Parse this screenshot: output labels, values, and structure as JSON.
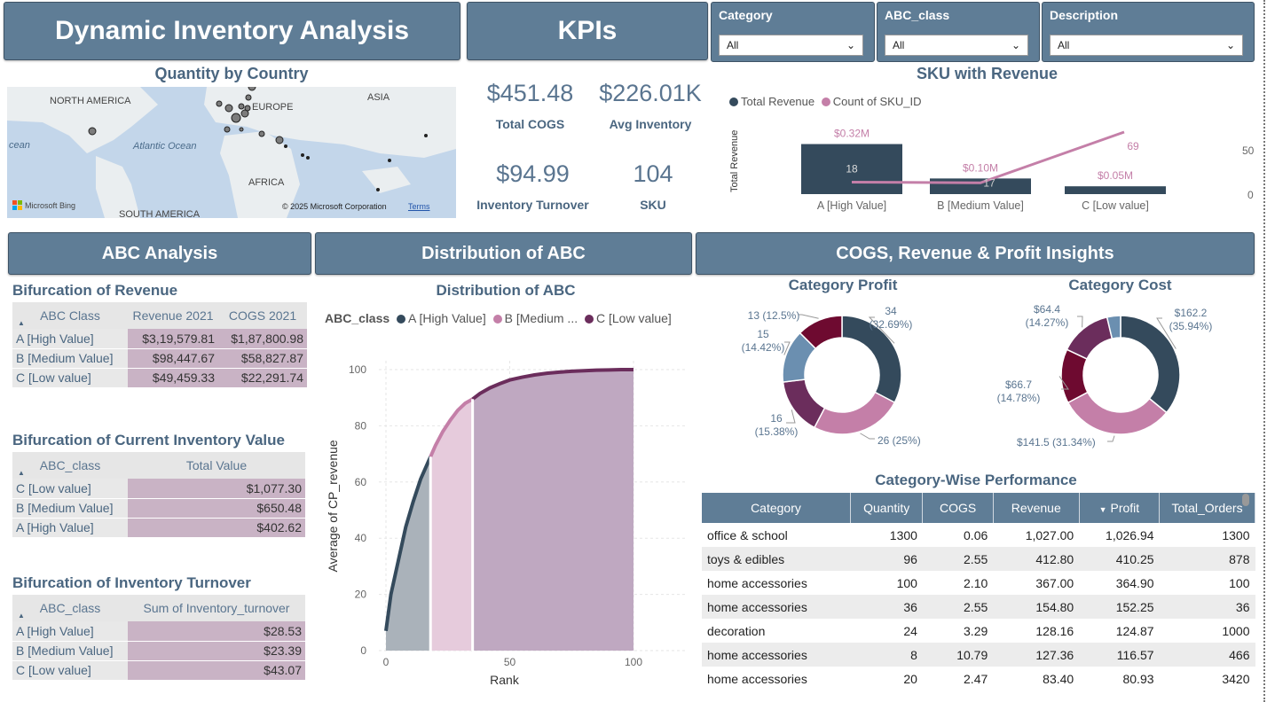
{
  "header": {
    "title": "Dynamic Inventory Analysis",
    "kpi_title": "KPIs"
  },
  "slicers": [
    {
      "label": "Category",
      "value": "All"
    },
    {
      "label": "ABC_class",
      "value": "All"
    },
    {
      "label": "Description",
      "value": "All"
    }
  ],
  "map": {
    "title": "Quantity by Country",
    "labels": {
      "north_america": "NORTH AMERICA",
      "europe": "EUROPE",
      "asia": "ASIA",
      "africa": "AFRICA",
      "south_america": "SOUTH AMERICA",
      "ocean_atlantic": "Atlantic Ocean",
      "ocean_left": "cean"
    },
    "bing": "Microsoft Bing",
    "copyright": "© 2025 Microsoft Corporation",
    "terms": "Terms"
  },
  "kpis": [
    {
      "value": "$451.48",
      "label": "Total COGS"
    },
    {
      "value": "$226.01K",
      "label": "Avg Inventory"
    },
    {
      "value": "$94.99",
      "label": "Inventory Turnover"
    },
    {
      "value": "104",
      "label": "SKU"
    }
  ],
  "sections": {
    "abc": "ABC  Analysis",
    "dist": "Distribution of ABC",
    "insights": "COGS, Revenue & Profit Insights"
  },
  "revenue_table": {
    "title": "Bifurcation of Revenue",
    "headers": [
      "ABC Class",
      "Revenue 2021",
      "COGS 2021"
    ],
    "rows": [
      [
        "A [High Value]",
        "$3,19,579.81",
        "$1,87,800.98"
      ],
      [
        "B [Medium Value]",
        "$98,447.67",
        "$58,827.87"
      ],
      [
        "C [Low value]",
        "$49,459.33",
        "$22,291.74"
      ]
    ]
  },
  "inventory_table": {
    "title": "Bifurcation of Current Inventory Value",
    "headers": [
      "ABC_class",
      "Total Value"
    ],
    "rows": [
      [
        "C [Low value]",
        "$1,077.30"
      ],
      [
        "B [Medium Value]",
        "$650.48"
      ],
      [
        "A [High Value]",
        "$402.62"
      ]
    ]
  },
  "turnover_table": {
    "title": "Bifurcation of Inventory Turnover",
    "headers": [
      "ABC_class",
      "Sum of Inventory_turnover"
    ],
    "rows": [
      [
        "A [High Value]",
        "$28.53"
      ],
      [
        "B [Medium Value]",
        "$23.39"
      ],
      [
        "C [Low value]",
        "$43.07"
      ]
    ]
  },
  "perf_table": {
    "title": "Category-Wise Performance",
    "headers": [
      "Category",
      "Quantity",
      "COGS",
      "Revenue",
      "Profit",
      "Total_Orders"
    ],
    "rows": [
      [
        "office & school",
        "1300",
        "0.06",
        "1,027.00",
        "1,026.94",
        "1300"
      ],
      [
        "toys & edibles",
        "96",
        "2.55",
        "412.80",
        "410.25",
        "878"
      ],
      [
        "home accessories",
        "100",
        "2.10",
        "367.00",
        "364.90",
        "100"
      ],
      [
        "home accessories",
        "36",
        "2.55",
        "154.80",
        "152.25",
        "36"
      ],
      [
        "decoration",
        "24",
        "3.29",
        "128.16",
        "124.87",
        "1000"
      ],
      [
        "home accessories",
        "8",
        "10.79",
        "127.36",
        "116.57",
        "466"
      ],
      [
        "home accessories",
        "20",
        "2.47",
        "83.40",
        "80.93",
        "3420"
      ]
    ]
  },
  "colors": {
    "a": "#344a5c",
    "b": "#c47fa8",
    "c": "#6b2d5c",
    "d": "#6b8fb0",
    "e": "#6e0a30",
    "banner": "#5f7d96"
  },
  "chart_data": [
    {
      "type": "bar",
      "title": "SKU with Revenue",
      "legend": [
        "Total Revenue",
        "Count of SKU_ID"
      ],
      "legend_position": "top-left",
      "categories": [
        "A [High Value]",
        "B [Medium Value]",
        "C [Low value]"
      ],
      "series": [
        {
          "name": "Total Revenue",
          "values": [
            0.32,
            0.1,
            0.05
          ],
          "labels": [
            "$0.32M",
            "$0.10M",
            "$0.05M"
          ]
        },
        {
          "name": "Count of SKU_ID",
          "values": [
            18,
            17,
            69
          ],
          "labels": [
            "18",
            "17",
            "69"
          ]
        }
      ],
      "ylabel": "Total Revenue",
      "y2_ticks": [
        "50",
        "0"
      ]
    },
    {
      "type": "area",
      "title": "Distribution of ABC",
      "legend_title": "ABC_class",
      "legend": [
        "A [High Value]",
        "B [Medium ...",
        "C [Low value]"
      ],
      "xlabel": "Rank",
      "ylabel": "Average of CP_revenue",
      "x_ticks": [
        "0",
        "50",
        "100"
      ],
      "y_ticks": [
        "0",
        "20",
        "40",
        "60",
        "80",
        "100"
      ],
      "xlim": [
        0,
        100
      ],
      "ylim": [
        0,
        100
      ],
      "x": [
        0,
        2,
        5,
        8,
        11,
        14,
        17,
        18,
        20,
        23,
        26,
        29,
        32,
        35,
        38,
        42,
        46,
        50,
        55,
        60,
        65,
        70,
        75,
        80,
        85,
        90,
        95,
        100
      ],
      "y": [
        7,
        20,
        32,
        44,
        53,
        61,
        67,
        69,
        73,
        78,
        82,
        85.5,
        88,
        89.5,
        91.5,
        93.5,
        95,
        96.3,
        97.3,
        98.1,
        98.7,
        99.1,
        99.4,
        99.6,
        99.8,
        99.9,
        100,
        100
      ],
      "segments": [
        {
          "name": "A [High Value]",
          "from": 0,
          "to": 18
        },
        {
          "name": "B [Medium ...",
          "from": 18,
          "to": 35
        },
        {
          "name": "C [Low value]",
          "from": 35,
          "to": 100
        }
      ],
      "grid": true
    },
    {
      "type": "pie",
      "title": "Category Profit",
      "values": [
        34,
        26,
        16,
        15,
        13
      ],
      "labels": [
        "34\n(32.69%)",
        "26 (25%)",
        "16\n(15.38%)",
        "15\n(14.42%)",
        "13 (12.5%)"
      ],
      "colors": [
        "#344a5c",
        "#c47fa8",
        "#6b2d5c",
        "#6b8fb0",
        "#6e0a30"
      ]
    },
    {
      "type": "pie",
      "title": "Category Cost",
      "values": [
        162.2,
        141.5,
        66.7,
        64.4,
        16.6
      ],
      "labels": [
        "$162.2\n(35.94%)",
        "$141.5 (31.34%)",
        "$66.7\n(14.78%)",
        "$64.4\n(14.27%)",
        ""
      ],
      "colors": [
        "#344a5c",
        "#c47fa8",
        "#6e0a30",
        "#6b2d5c",
        "#6b8fb0"
      ]
    }
  ]
}
